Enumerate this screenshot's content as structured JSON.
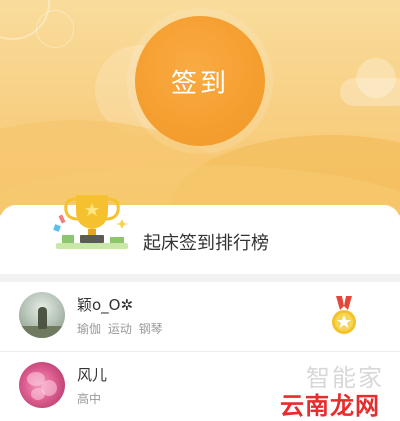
{
  "header": {
    "signin_label": "签到"
  },
  "ranking": {
    "title": "起床签到排行榜"
  },
  "users": [
    {
      "name": "颖o_O✲",
      "tags": "瑜伽 运动 钢琴"
    },
    {
      "name": "风儿",
      "tags": "高中"
    }
  ],
  "watermark": {
    "text1": "智能家",
    "text2": "云南龙网"
  },
  "colors": {
    "signin": "#f59e30",
    "hero": "#f8cf82",
    "medal_gold": "#f4c22b",
    "medal_ribbon": "#e2483c"
  }
}
